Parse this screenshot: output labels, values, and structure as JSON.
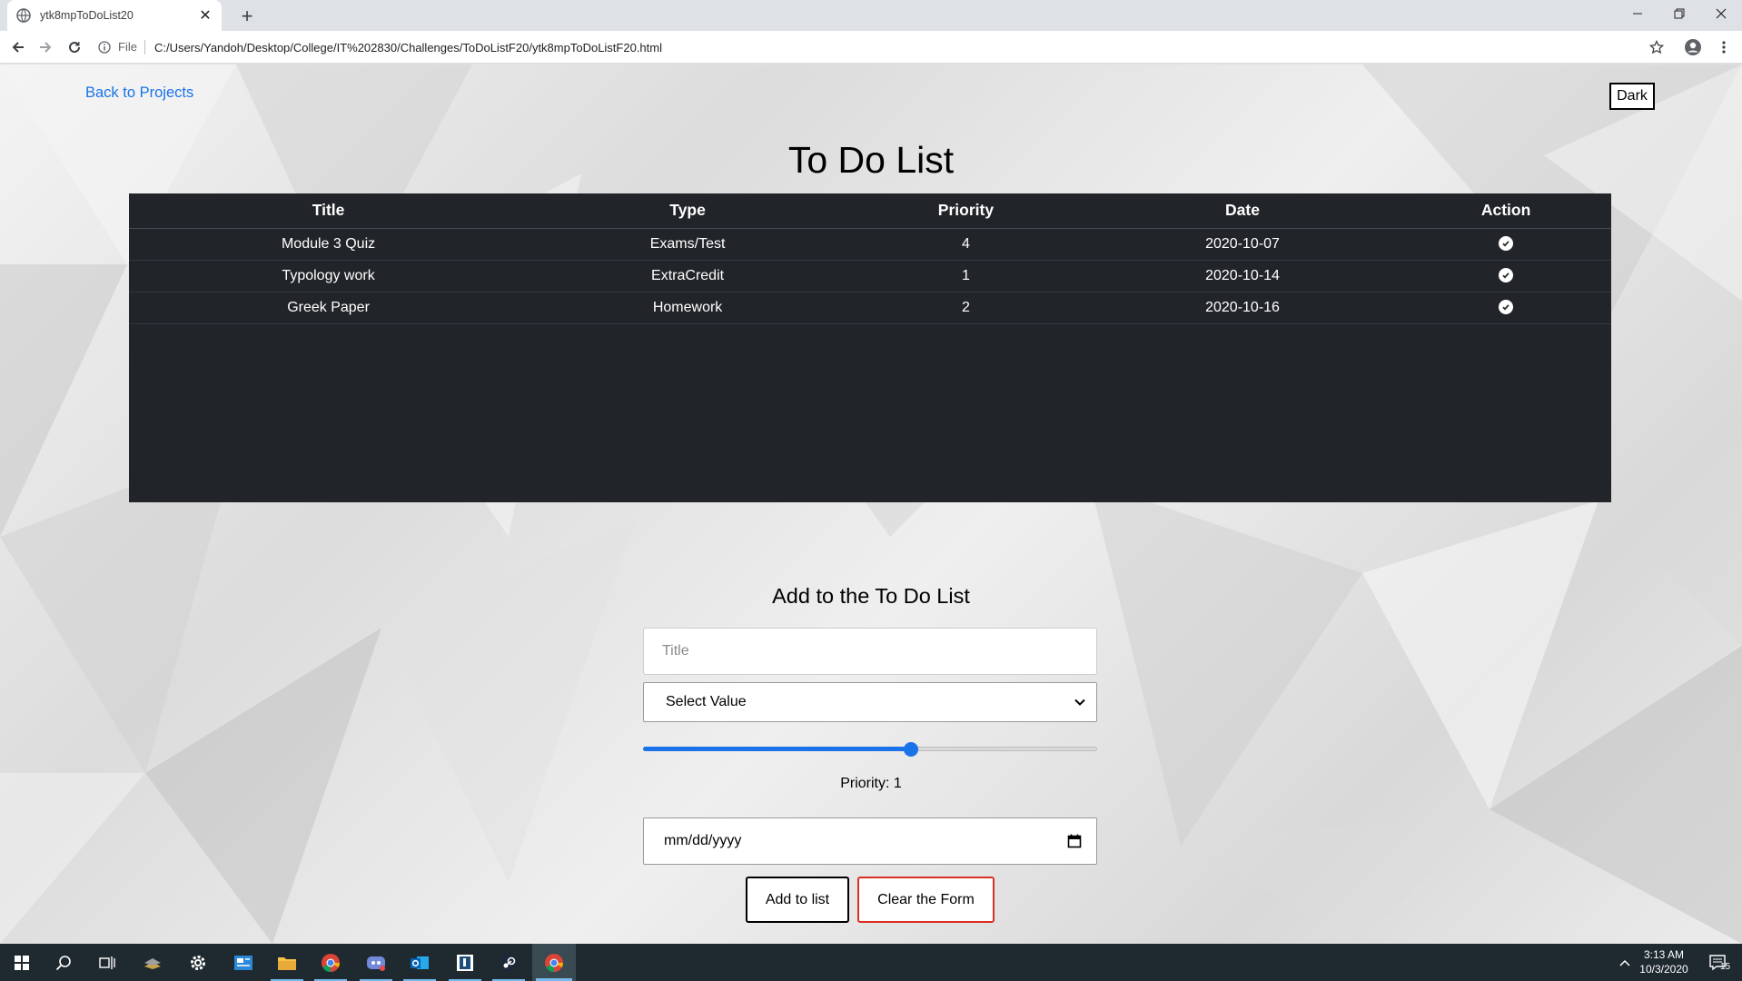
{
  "browser": {
    "tab_title": "ytk8mpToDoList20",
    "file_label": "File",
    "url": "C:/Users/Yandoh/Desktop/College/IT%202830/Challenges/ToDoListF20/ytk8mpToDoListF20.html"
  },
  "page": {
    "back_link": "Back to Projects",
    "theme_button": "Dark",
    "heading": "To Do List",
    "table": {
      "headers": [
        "Title",
        "Type",
        "Priority",
        "Date",
        "Action"
      ],
      "rows": [
        {
          "title": "Module 3 Quiz",
          "type": "Exams/Test",
          "priority": "4",
          "date": "2020-10-07"
        },
        {
          "title": "Typology work",
          "type": "ExtraCredit",
          "priority": "1",
          "date": "2020-10-14"
        },
        {
          "title": "Greek Paper",
          "type": "Homework",
          "priority": "2",
          "date": "2020-10-16"
        }
      ]
    },
    "form": {
      "title": "Add to the To Do List",
      "title_placeholder": "Title",
      "select_value": "Select Value",
      "slider_fraction": 0.59,
      "priority_label": "Priority: 1",
      "date_placeholder": "mm/dd/yyyy",
      "add_button": "Add to list",
      "clear_button": "Clear the Form"
    }
  },
  "taskbar": {
    "time": "3:13 AM",
    "date": "10/3/2020",
    "notification_count": "15"
  },
  "colors": {
    "table_bg": "#212529",
    "link": "#1a73e8",
    "clear_border": "#d93025",
    "taskbar_bg": "#1f2a30"
  }
}
